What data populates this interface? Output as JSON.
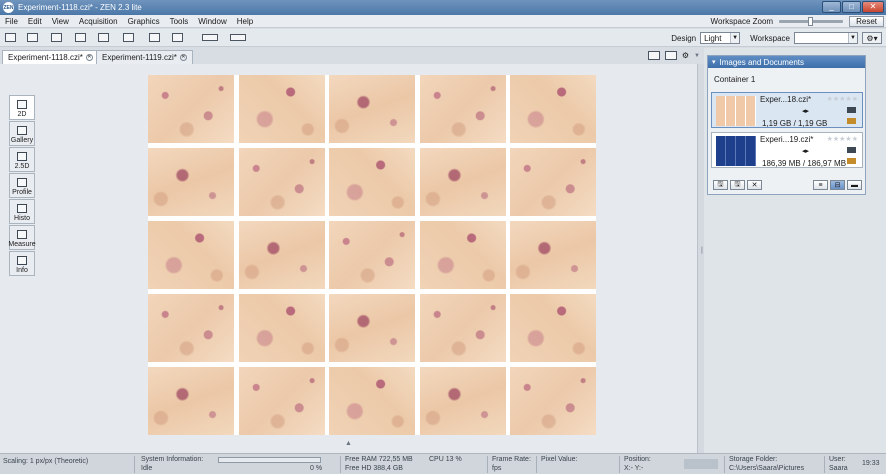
{
  "window": {
    "title": "Experiment-1118.czi* - ZEN 2.3 lite",
    "logo_text": "ZEN",
    "controls": [
      "_",
      "□",
      "✕"
    ]
  },
  "menu": [
    "File",
    "Edit",
    "View",
    "Acquisition",
    "Graphics",
    "Tools",
    "Window",
    "Help"
  ],
  "workspace_zoom": {
    "label": "Workspace Zoom",
    "reset_label": "Reset"
  },
  "toolbar": {
    "design_label": "Design",
    "design_value": "Light",
    "workspace_label": "Workspace",
    "workspace_value": "",
    "gear": "⚙▾"
  },
  "tabs": [
    {
      "label": "Experiment-1118.czi*",
      "active": true
    },
    {
      "label": "Experiment-1119.czi*",
      "active": false
    }
  ],
  "left_panel": {
    "items": [
      {
        "label": "2D",
        "active": true
      },
      {
        "label": "Gallery",
        "active": false
      },
      {
        "label": "2.5D",
        "active": false
      },
      {
        "label": "Profile",
        "active": false
      },
      {
        "label": "Histo",
        "active": false
      },
      {
        "label": "Measure",
        "active": false
      },
      {
        "label": "Info",
        "active": false
      }
    ]
  },
  "docs_panel": {
    "title": "Images and Documents",
    "container": "Container 1",
    "documents": [
      {
        "name": "Exper...18.czi*",
        "size": "1,19 GB / 1,19 GB",
        "mode": "◂▸",
        "stars": "★★★★★",
        "selected": true
      },
      {
        "name": "Experi...19.czi*",
        "size": "186,39 MB / 186,97 MB",
        "mode": "◂▸",
        "stars": "★★★★★",
        "selected": false
      }
    ],
    "footer_left": [
      "🖫",
      "🖫",
      "✕"
    ],
    "footer_right": [
      "≡",
      "⊟",
      "▬"
    ]
  },
  "statusbar": {
    "scaling": "Scaling:  1 px/px (Theoretic)",
    "sysinfo_label": "System Information:",
    "sysinfo_value": "Idle",
    "progress_percent": "0 %",
    "progress_value": 0,
    "free_ram": "Free RAM  722,55 MB",
    "free_hd": "Free HD   388,4 GB",
    "cpu": "CPU  13 %",
    "frame_rate_label": "Frame Rate:",
    "frame_rate_value": "fps",
    "pixel_value_label": "Pixel Value:",
    "position_label": "Position:",
    "position_value": "X:-     Y:-",
    "storage_label": "Storage Folder:",
    "storage_value": "C:\\Users\\Saara\\Pictures",
    "user_label": "User:",
    "user_value": "Saara",
    "clock": "19:33"
  },
  "colors": {
    "titlebar": "#4b77a8",
    "panel_header": "#3e6fa9",
    "sample_background": "#efc9a8",
    "stain": "#a0306a"
  }
}
